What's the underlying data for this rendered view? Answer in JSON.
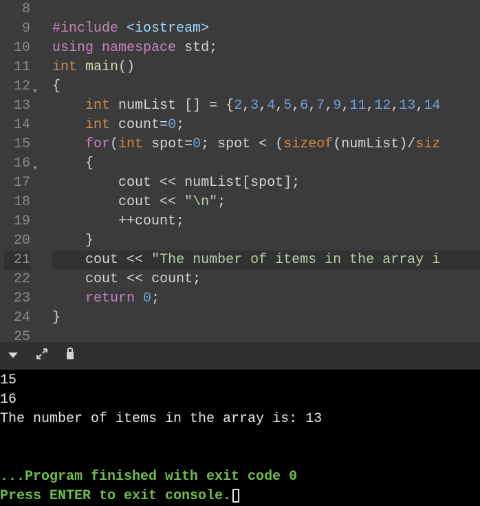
{
  "editor": {
    "first_line_number": 8,
    "lines": [
      {
        "num": 8,
        "tokens": []
      },
      {
        "num": 9,
        "tokens": [
          {
            "cls": "t-pp",
            "text": "#include"
          },
          {
            "cls": "",
            "text": " "
          },
          {
            "cls": "t-inc",
            "text": "<iostream>"
          }
        ]
      },
      {
        "num": 10,
        "tokens": [
          {
            "cls": "t-kw",
            "text": "using"
          },
          {
            "cls": "",
            "text": " "
          },
          {
            "cls": "t-kw",
            "text": "namespace"
          },
          {
            "cls": "",
            "text": " "
          },
          {
            "cls": "t-id",
            "text": "std"
          },
          {
            "cls": "t-pun",
            "text": ";"
          }
        ]
      },
      {
        "num": 11,
        "tokens": [
          {
            "cls": "t-type",
            "text": "int"
          },
          {
            "cls": "",
            "text": " "
          },
          {
            "cls": "t-fn",
            "text": "main"
          },
          {
            "cls": "t-pun",
            "text": "()"
          }
        ]
      },
      {
        "num": 12,
        "fold": true,
        "tokens": [
          {
            "cls": "t-pun",
            "text": "{"
          }
        ]
      },
      {
        "num": 13,
        "tokens": [
          {
            "cls": "",
            "text": "    "
          },
          {
            "cls": "t-type",
            "text": "int"
          },
          {
            "cls": "",
            "text": " "
          },
          {
            "cls": "t-id",
            "text": "numList []"
          },
          {
            "cls": "",
            "text": " "
          },
          {
            "cls": "t-op",
            "text": "="
          },
          {
            "cls": "",
            "text": " "
          },
          {
            "cls": "t-pun",
            "text": "{"
          },
          {
            "cls": "t-num",
            "text": "2"
          },
          {
            "cls": "t-pun",
            "text": ","
          },
          {
            "cls": "t-num",
            "text": "3"
          },
          {
            "cls": "t-pun",
            "text": ","
          },
          {
            "cls": "t-num",
            "text": "4"
          },
          {
            "cls": "t-pun",
            "text": ","
          },
          {
            "cls": "t-num",
            "text": "5"
          },
          {
            "cls": "t-pun",
            "text": ","
          },
          {
            "cls": "t-num",
            "text": "6"
          },
          {
            "cls": "t-pun",
            "text": ","
          },
          {
            "cls": "t-num",
            "text": "7"
          },
          {
            "cls": "t-pun",
            "text": ","
          },
          {
            "cls": "t-num",
            "text": "9"
          },
          {
            "cls": "t-pun",
            "text": ","
          },
          {
            "cls": "t-num",
            "text": "11"
          },
          {
            "cls": "t-pun",
            "text": ","
          },
          {
            "cls": "t-num",
            "text": "12"
          },
          {
            "cls": "t-pun",
            "text": ","
          },
          {
            "cls": "t-num",
            "text": "13"
          },
          {
            "cls": "t-pun",
            "text": ","
          },
          {
            "cls": "t-num",
            "text": "14"
          }
        ]
      },
      {
        "num": 14,
        "tokens": [
          {
            "cls": "",
            "text": "    "
          },
          {
            "cls": "t-type",
            "text": "int"
          },
          {
            "cls": "",
            "text": " "
          },
          {
            "cls": "t-id",
            "text": "count"
          },
          {
            "cls": "t-op",
            "text": "="
          },
          {
            "cls": "t-num",
            "text": "0"
          },
          {
            "cls": "t-pun",
            "text": ";"
          }
        ]
      },
      {
        "num": 15,
        "tokens": [
          {
            "cls": "",
            "text": "    "
          },
          {
            "cls": "t-kw",
            "text": "for"
          },
          {
            "cls": "t-pun",
            "text": "("
          },
          {
            "cls": "t-type",
            "text": "int"
          },
          {
            "cls": "",
            "text": " "
          },
          {
            "cls": "t-id",
            "text": "spot"
          },
          {
            "cls": "t-op",
            "text": "="
          },
          {
            "cls": "t-num",
            "text": "0"
          },
          {
            "cls": "t-pun",
            "text": ";"
          },
          {
            "cls": "",
            "text": " "
          },
          {
            "cls": "t-id",
            "text": "spot"
          },
          {
            "cls": "",
            "text": " "
          },
          {
            "cls": "t-op",
            "text": "<"
          },
          {
            "cls": "",
            "text": " "
          },
          {
            "cls": "t-pun",
            "text": "("
          },
          {
            "cls": "t-type",
            "text": "sizeof"
          },
          {
            "cls": "t-pun",
            "text": "("
          },
          {
            "cls": "t-id",
            "text": "numList"
          },
          {
            "cls": "t-pun",
            "text": ")"
          },
          {
            "cls": "t-op",
            "text": "/"
          },
          {
            "cls": "t-type",
            "text": "siz"
          }
        ]
      },
      {
        "num": 16,
        "fold": true,
        "tokens": [
          {
            "cls": "",
            "text": "    "
          },
          {
            "cls": "t-pun",
            "text": "{"
          }
        ]
      },
      {
        "num": 17,
        "tokens": [
          {
            "cls": "",
            "text": "        "
          },
          {
            "cls": "t-id",
            "text": "cout"
          },
          {
            "cls": "",
            "text": " "
          },
          {
            "cls": "t-op",
            "text": "<<"
          },
          {
            "cls": "",
            "text": " "
          },
          {
            "cls": "t-id",
            "text": "numList"
          },
          {
            "cls": "t-pun",
            "text": "["
          },
          {
            "cls": "t-id",
            "text": "spot"
          },
          {
            "cls": "t-pun",
            "text": "]"
          },
          {
            "cls": "t-pun",
            "text": ";"
          }
        ]
      },
      {
        "num": 18,
        "tokens": [
          {
            "cls": "",
            "text": "        "
          },
          {
            "cls": "t-id",
            "text": "cout"
          },
          {
            "cls": "",
            "text": " "
          },
          {
            "cls": "t-op",
            "text": "<<"
          },
          {
            "cls": "",
            "text": " "
          },
          {
            "cls": "t-str",
            "text": "\"\\n\""
          },
          {
            "cls": "t-pun",
            "text": ";"
          }
        ]
      },
      {
        "num": 19,
        "tokens": [
          {
            "cls": "",
            "text": "        "
          },
          {
            "cls": "t-op",
            "text": "++"
          },
          {
            "cls": "t-id",
            "text": "count"
          },
          {
            "cls": "t-pun",
            "text": ";"
          }
        ]
      },
      {
        "num": 20,
        "tokens": [
          {
            "cls": "",
            "text": "    "
          },
          {
            "cls": "t-pun",
            "text": "}"
          }
        ]
      },
      {
        "num": 21,
        "highlight": true,
        "tokens": [
          {
            "cls": "",
            "text": "    "
          },
          {
            "cls": "t-id",
            "text": "cout"
          },
          {
            "cls": "",
            "text": " "
          },
          {
            "cls": "t-op",
            "text": "<<"
          },
          {
            "cls": "",
            "text": " "
          },
          {
            "cls": "t-str",
            "text": "\"The number of items in the array i"
          }
        ]
      },
      {
        "num": 22,
        "tokens": [
          {
            "cls": "",
            "text": "    "
          },
          {
            "cls": "t-id",
            "text": "cout"
          },
          {
            "cls": "",
            "text": " "
          },
          {
            "cls": "t-op",
            "text": "<<"
          },
          {
            "cls": "",
            "text": " "
          },
          {
            "cls": "t-id",
            "text": "count"
          },
          {
            "cls": "t-pun",
            "text": ";"
          }
        ]
      },
      {
        "num": 23,
        "tokens": [
          {
            "cls": "",
            "text": "    "
          },
          {
            "cls": "t-kw",
            "text": "return"
          },
          {
            "cls": "",
            "text": " "
          },
          {
            "cls": "t-num",
            "text": "0"
          },
          {
            "cls": "t-pun",
            "text": ";"
          }
        ]
      },
      {
        "num": 24,
        "tokens": [
          {
            "cls": "t-pun",
            "text": "}"
          }
        ]
      },
      {
        "num": 25,
        "tokens": []
      }
    ]
  },
  "console": {
    "lines": [
      "15",
      "16",
      "The number of items in the array is: 13",
      "",
      ""
    ],
    "exit_line": "...Program finished with exit code 0",
    "prompt_line": "Press ENTER to exit console."
  }
}
